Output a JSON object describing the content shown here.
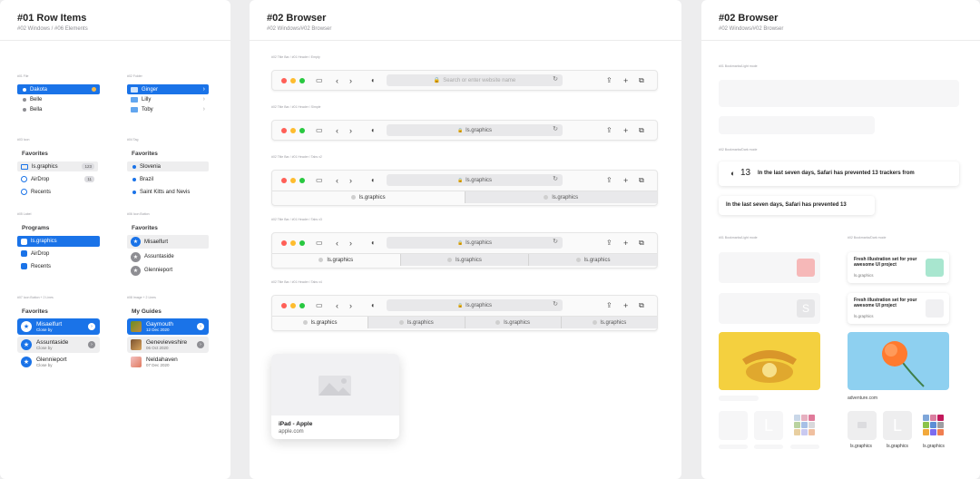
{
  "panel1": {
    "title": "#01 Row Items",
    "subtitle": "#02 Windows / #06 Elements",
    "s_file": "#01 File",
    "s_folder": "#02 Folder",
    "s_icon": "#03 Icon",
    "s_tag": "#04 Tag",
    "s_label": "#05 Label",
    "s_icon_button": "#06 Icon Button",
    "s_icon_button_2": "#07 Icon Button + 2 Lines",
    "s_image": "#08 Image + 2 Lines",
    "files": [
      "Dakota",
      "Belle",
      "Bella"
    ],
    "folders": [
      "Ginger",
      "Lilly",
      "Toby"
    ],
    "favorites_heading": "Favorites",
    "icon_rows": [
      {
        "label": "ls.graphics",
        "badge": "123"
      },
      {
        "label": "AirDrop",
        "badge": "11"
      },
      {
        "label": "Recents",
        "badge": ""
      }
    ],
    "tag_rows": [
      "Slovenia",
      "Brazil",
      "Saint Kitts and Nevis"
    ],
    "programs_heading": "Programs",
    "label_rows": [
      "ls.graphics",
      "AirDrop",
      "Recents"
    ],
    "icon_button_rows": [
      "Misaelfurt",
      "Assuntaside",
      "Glennieport"
    ],
    "two_line_rows": [
      {
        "t1": "Misaelfurt",
        "t2": "Close by"
      },
      {
        "t1": "Assuntaside",
        "t2": "Close by"
      },
      {
        "t1": "Glennieport",
        "t2": "Close by"
      }
    ],
    "guides_heading": "My Guides",
    "image_rows": [
      {
        "t1": "Gaymouth",
        "t2": "12 Dec 2020"
      },
      {
        "t1": "Genevieveshire",
        "t2": "06 Oct 2020"
      },
      {
        "t1": "Neldahaven",
        "t2": "07 Dec 2020"
      }
    ]
  },
  "panel2": {
    "title": "#02 Browser",
    "subtitle": "#02 Windows/#02 Browser",
    "labels": [
      "#02 Title Bar / #01 Header / Empty",
      "#02 Title Bar / #01 Header / Simple",
      "#02 Title Bar / #01 Header / Tabs x2",
      "#02 Title Bar / #01 Header / Tabs x3",
      "#02 Title Bar / #01 Header / Tabs x4"
    ],
    "search_placeholder": "Search or enter website name",
    "url": "ls.graphics",
    "tab_label": "ls.graphics",
    "card_title": "iPad - Apple",
    "card_url": "apple.com"
  },
  "panel3": {
    "title": "#02 Browser",
    "subtitle": "#02 Windows/#02 Browser",
    "s_light": "#01 Bookmarks/Light mode",
    "s_dark": "#02 Bookmarks/Dark mode",
    "s_light2": "#01 Bookmarks/Light mode",
    "s_dark2": "#02 Bookmarks/Dark mode",
    "tracker_count": "13",
    "tracker_text_1": "In the last seven days, Safari has prevented 13 trackers from",
    "tracker_text_2": "In the last seven days, Safari has prevented 13",
    "fresh_title": "Fresh illustration set for your awesome UI project",
    "fresh_source": "ls.graphics",
    "adventure": "adventure.com",
    "tile_label": "ls.graphics",
    "tile_letter_s": "S",
    "tile_letter_l": "L"
  },
  "colors": {
    "accent": "#1a73e8",
    "traffic_red": "#ff5f57",
    "traffic_yellow": "#febc2e",
    "traffic_green": "#28c840"
  }
}
